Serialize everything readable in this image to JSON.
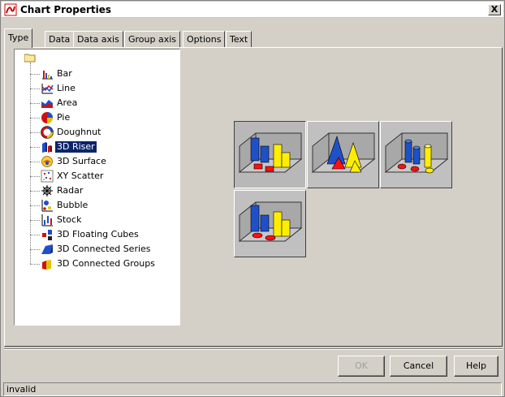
{
  "window": {
    "title": "Chart Properties",
    "close_label": "X"
  },
  "tabs": [
    {
      "label": "Type",
      "active": true
    },
    {
      "label": "Data"
    },
    {
      "label": "Data axis"
    },
    {
      "label": "Group axis"
    },
    {
      "label": "Options"
    },
    {
      "label": "Text"
    }
  ],
  "tree": {
    "items": [
      {
        "label": "Bar",
        "icon": "bar-chart-icon"
      },
      {
        "label": "Line",
        "icon": "line-chart-icon"
      },
      {
        "label": "Area",
        "icon": "area-chart-icon"
      },
      {
        "label": "Pie",
        "icon": "pie-chart-icon"
      },
      {
        "label": "Doughnut",
        "icon": "doughnut-chart-icon"
      },
      {
        "label": "3D Riser",
        "icon": "3d-riser-icon",
        "selected": true
      },
      {
        "label": "3D Surface",
        "icon": "3d-surface-icon"
      },
      {
        "label": "XY Scatter",
        "icon": "xy-scatter-icon"
      },
      {
        "label": "Radar",
        "icon": "radar-chart-icon"
      },
      {
        "label": "Bubble",
        "icon": "bubble-chart-icon"
      },
      {
        "label": "Stock",
        "icon": "stock-chart-icon"
      },
      {
        "label": "3D Floating Cubes",
        "icon": "3d-floating-cubes-icon"
      },
      {
        "label": "3D Connected Series",
        "icon": "3d-connected-series-icon"
      },
      {
        "label": "3D Connected Groups",
        "icon": "3d-connected-groups-icon"
      }
    ]
  },
  "subtypes": [
    {
      "name": "3d-riser-bars-thumbnail",
      "selected": true
    },
    {
      "name": "3d-riser-pyramids-thumbnail"
    },
    {
      "name": "3d-riser-cylinders-thumbnail"
    },
    {
      "name": "3d-riser-octagons-thumbnail"
    }
  ],
  "buttons": {
    "ok": "OK",
    "cancel": "Cancel",
    "help": "Help"
  },
  "status": {
    "text": "invalid"
  },
  "colors": {
    "selection": "#0a246a",
    "face": "#d4d0c8",
    "red": "#ff0000",
    "blue": "#1e50c8",
    "yellow": "#ffff00"
  }
}
